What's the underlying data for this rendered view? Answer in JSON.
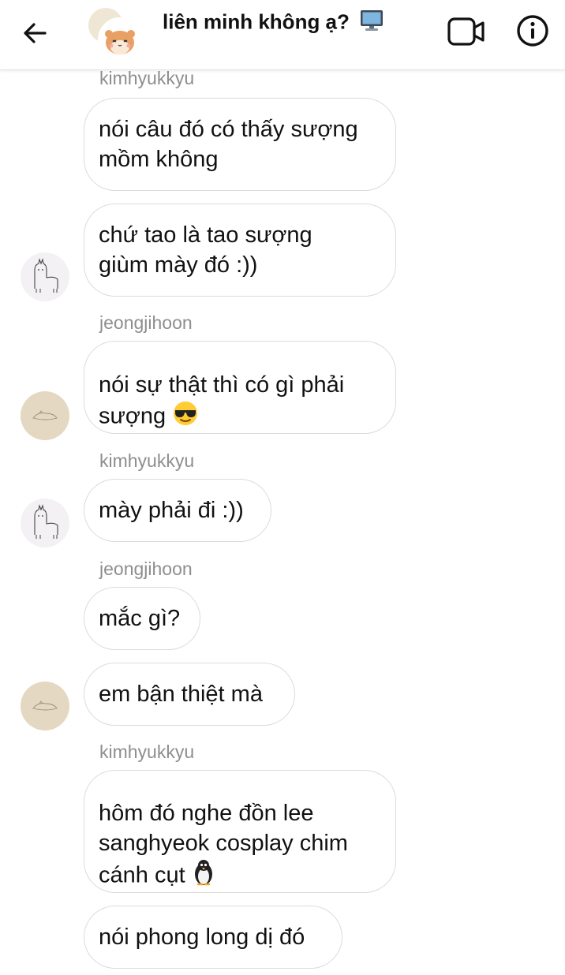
{
  "header": {
    "title": "liên minh không ạ?",
    "title_emoji_icon": "desktop-computer-icon",
    "back_icon": "arrow-left-icon",
    "video_icon": "video-call-icon",
    "info_icon": "info-icon"
  },
  "messages": [
    {
      "sender": "kimhyukkyu",
      "text": "nói câu đó có thấy sượng\nmồm không"
    },
    {
      "text": "chứ tao là tao sượng\ngiùm mày đó :))",
      "avatar": "llama-avatar"
    },
    {
      "sender": "jeongjihoon",
      "text": "nói sự thật thì có gì phải\nsượng",
      "emoji_icon": "sunglasses-face-icon",
      "avatar": "beige-avatar"
    },
    {
      "sender": "kimhyukkyu",
      "text": "mày phải đi :))",
      "avatar": "llama-avatar"
    },
    {
      "sender": "jeongjihoon",
      "text": "mắc gì?"
    },
    {
      "text": "em bận thiệt mà",
      "avatar": "beige-avatar"
    },
    {
      "sender": "kimhyukkyu",
      "text": "hôm đó nghe đồn lee\nsanghyeok cosplay chim\ncánh cụt",
      "emoji_icon": "penguin-icon"
    },
    {
      "text": "nói phong long dị đó"
    }
  ],
  "colors": {
    "bubble_border": "#dbdbdb",
    "sender_text": "#8e8e8e",
    "avatar_beige": "#e5d8c2"
  }
}
